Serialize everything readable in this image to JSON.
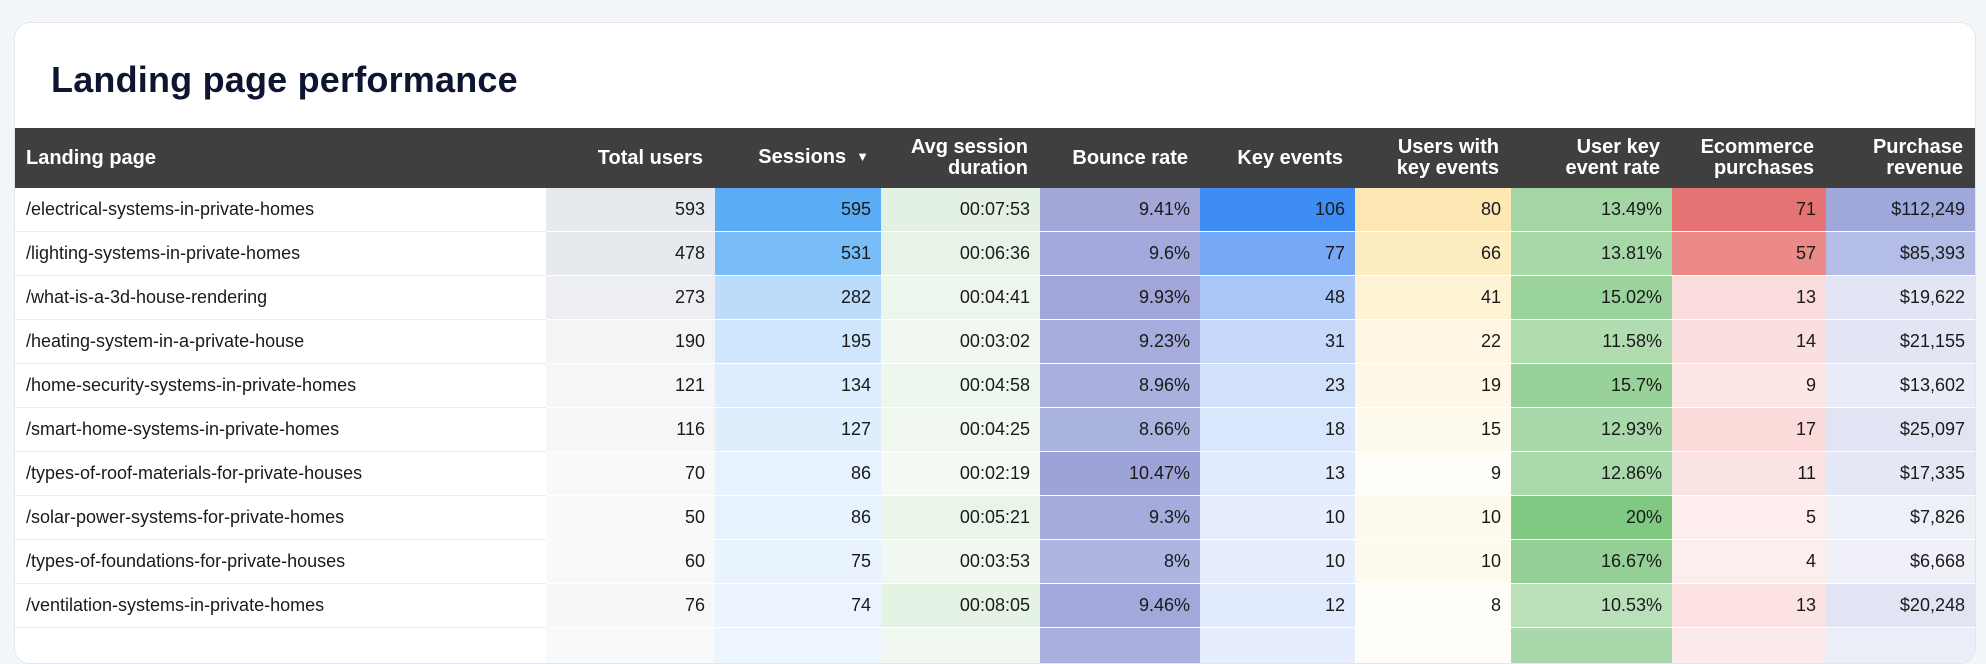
{
  "title": "Landing page performance",
  "columns": [
    {
      "label": "Landing page"
    },
    {
      "label": "Total users"
    },
    {
      "label": "Sessions",
      "sort_icon": "▼"
    },
    {
      "label_line1": "Avg session",
      "label_line2": "duration"
    },
    {
      "label": "Bounce rate"
    },
    {
      "label": "Key events"
    },
    {
      "label_line1": "Users with",
      "label_line2": "key events"
    },
    {
      "label_line1": "User key",
      "label_line2": "event rate"
    },
    {
      "label_line1": "Ecommerce",
      "label_line2": "purchases"
    },
    {
      "label_line1": "Purchase",
      "label_line2": "revenue"
    }
  ],
  "rows": [
    {
      "page": "/electrical-systems-in-private-homes",
      "total_users": "593",
      "sessions": "595",
      "avg_session_duration": "00:07:53",
      "bounce_rate": "9.41%",
      "key_events": "106",
      "users_with_key_events": "80",
      "user_key_event_rate": "13.49%",
      "ecommerce_purchases": "71",
      "purchase_revenue": "$112,249"
    },
    {
      "page": "/lighting-systems-in-private-homes",
      "total_users": "478",
      "sessions": "531",
      "avg_session_duration": "00:06:36",
      "bounce_rate": "9.6%",
      "key_events": "77",
      "users_with_key_events": "66",
      "user_key_event_rate": "13.81%",
      "ecommerce_purchases": "57",
      "purchase_revenue": "$85,393"
    },
    {
      "page": "/what-is-a-3d-house-rendering",
      "total_users": "273",
      "sessions": "282",
      "avg_session_duration": "00:04:41",
      "bounce_rate": "9.93%",
      "key_events": "48",
      "users_with_key_events": "41",
      "user_key_event_rate": "15.02%",
      "ecommerce_purchases": "13",
      "purchase_revenue": "$19,622"
    },
    {
      "page": "/heating-system-in-a-private-house",
      "total_users": "190",
      "sessions": "195",
      "avg_session_duration": "00:03:02",
      "bounce_rate": "9.23%",
      "key_events": "31",
      "users_with_key_events": "22",
      "user_key_event_rate": "11.58%",
      "ecommerce_purchases": "14",
      "purchase_revenue": "$21,155"
    },
    {
      "page": "/home-security-systems-in-private-homes",
      "total_users": "121",
      "sessions": "134",
      "avg_session_duration": "00:04:58",
      "bounce_rate": "8.96%",
      "key_events": "23",
      "users_with_key_events": "19",
      "user_key_event_rate": "15.7%",
      "ecommerce_purchases": "9",
      "purchase_revenue": "$13,602"
    },
    {
      "page": "/smart-home-systems-in-private-homes",
      "total_users": "116",
      "sessions": "127",
      "avg_session_duration": "00:04:25",
      "bounce_rate": "8.66%",
      "key_events": "18",
      "users_with_key_events": "15",
      "user_key_event_rate": "12.93%",
      "ecommerce_purchases": "17",
      "purchase_revenue": "$25,097"
    },
    {
      "page": "/types-of-roof-materials-for-private-houses",
      "total_users": "70",
      "sessions": "86",
      "avg_session_duration": "00:02:19",
      "bounce_rate": "10.47%",
      "key_events": "13",
      "users_with_key_events": "9",
      "user_key_event_rate": "12.86%",
      "ecommerce_purchases": "11",
      "purchase_revenue": "$17,335"
    },
    {
      "page": "/solar-power-systems-for-private-homes",
      "total_users": "50",
      "sessions": "86",
      "avg_session_duration": "00:05:21",
      "bounce_rate": "9.3%",
      "key_events": "10",
      "users_with_key_events": "10",
      "user_key_event_rate": "20%",
      "ecommerce_purchases": "5",
      "purchase_revenue": "$7,826"
    },
    {
      "page": "/types-of-foundations-for-private-houses",
      "total_users": "60",
      "sessions": "75",
      "avg_session_duration": "00:03:53",
      "bounce_rate": "8%",
      "key_events": "10",
      "users_with_key_events": "10",
      "user_key_event_rate": "16.67%",
      "ecommerce_purchases": "4",
      "purchase_revenue": "$6,668"
    },
    {
      "page": "/ventilation-systems-in-private-homes",
      "total_users": "76",
      "sessions": "74",
      "avg_session_duration": "00:08:05",
      "bounce_rate": "9.46%",
      "key_events": "12",
      "users_with_key_events": "8",
      "user_key_event_rate": "10.53%",
      "ecommerce_purchases": "13",
      "purchase_revenue": "$20,248"
    },
    {
      "page": "",
      "total_users": "",
      "sessions": "",
      "avg_session_duration": "",
      "bounce_rate": "",
      "key_events": "",
      "users_with_key_events": "",
      "user_key_event_rate": "",
      "ecommerce_purchases": "",
      "purchase_revenue": ""
    }
  ],
  "cell_colors": [
    [
      "#e6e9ed",
      "#5aacf5",
      "#e3f1e4",
      "#a2a7d8",
      "#3d8df4",
      "#fde8b3",
      "#a3d6a4",
      "#e57373",
      "#9fa8db"
    ],
    [
      "#e6e9ed",
      "#79bdf8",
      "#e6f3e6",
      "#a3a9dc",
      "#77a8f6",
      "#feedc0",
      "#a7d9a8",
      "#ec8a8a",
      "#b4bde5"
    ],
    [
      "#eceef1",
      "#bcdcfb",
      "#ecf6ec",
      "#a1a5d8",
      "#a9c8f9",
      "#fff3d6",
      "#9bd39c",
      "#fadcdc",
      "#e2e6f4"
    ],
    [
      "#f2f4f6",
      "#cfe6fc",
      "#f1f8f1",
      "#a6acdb",
      "#c6d9fb",
      "#fff7e3",
      "#b0dcb0",
      "#fbdede",
      "#e2e5f3"
    ],
    [
      "#f5f6f8",
      "#ddedfd",
      "#eef7ee",
      "#a9b0de",
      "#d2e1fb",
      "#fff8e8",
      "#98d199",
      "#fce6e6",
      "#e9ebf6"
    ],
    [
      "#f5f6f8",
      "#deeefd",
      "#f0f8f0",
      "#aab2de",
      "#d9e6fc",
      "#fffaee",
      "#a9d9aa",
      "#fbdada",
      "#e1e4f3"
    ],
    [
      "#f8f9fa",
      "#e6f2fe",
      "#f5faf5",
      "#9ea3d7",
      "#e1ebfd",
      "#fffdf7",
      "#aad9ab",
      "#fce3e3",
      "#e4e7f4"
    ],
    [
      "#f9fafb",
      "#e6f2fe",
      "#eaf5ea",
      "#a5abda",
      "#e6eefd",
      "#fffaee",
      "#80c983",
      "#fdeded",
      "#eef0f8"
    ],
    [
      "#f8f9fa",
      "#e9f3fe",
      "#f1f8f1",
      "#aeb5e0",
      "#e6eefd",
      "#fffaee",
      "#94cf96",
      "#fdeeee",
      "#eff0f8"
    ],
    [
      "#f6f7f9",
      "#ebf4fe",
      "#e5f3e5",
      "#a2a8d9",
      "#e2ebfd",
      "#fffdf7",
      "#bae0ba",
      "#fce2e2",
      "#e1e4f3"
    ],
    [
      "#f8f9fa",
      "#edf5fe",
      "#f1f8f1",
      "#aab0dd",
      "#e6eefd",
      "#fffdf7",
      "#a9d9aa",
      "#fce9e9",
      "#eceef7"
    ]
  ]
}
